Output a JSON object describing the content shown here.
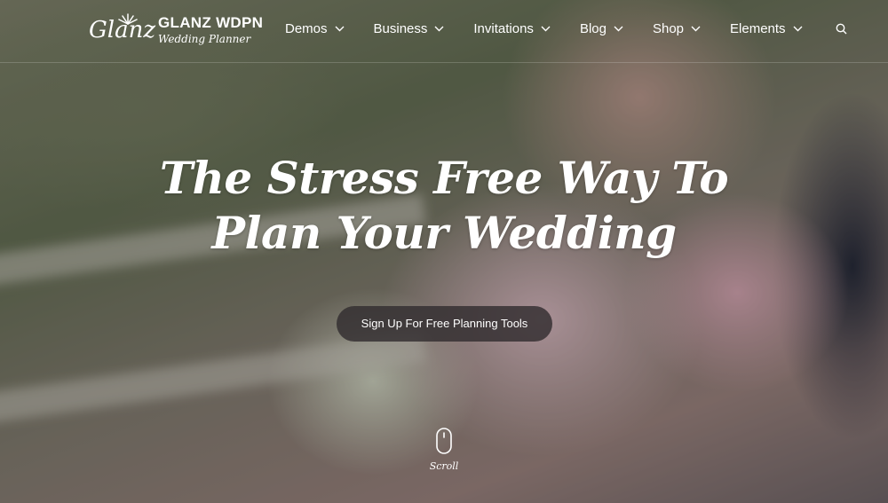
{
  "brand": {
    "logo_script": "Glanz",
    "name": "GLANZ WDPN",
    "tagline": "Wedding Planner"
  },
  "nav": {
    "items": [
      {
        "label": "Demos"
      },
      {
        "label": "Business"
      },
      {
        "label": "Invitations"
      },
      {
        "label": "Blog"
      },
      {
        "label": "Shop"
      },
      {
        "label": "Elements"
      }
    ],
    "search_icon": "search-icon"
  },
  "hero": {
    "headline_line1": "The Stress Free Way To",
    "headline_line2": "Plan Your Wedding",
    "cta_label": "Sign Up For Free Planning Tools",
    "scroll_label": "Scroll"
  },
  "colors": {
    "text": "#ffffff",
    "cta_background": "#322d30"
  }
}
